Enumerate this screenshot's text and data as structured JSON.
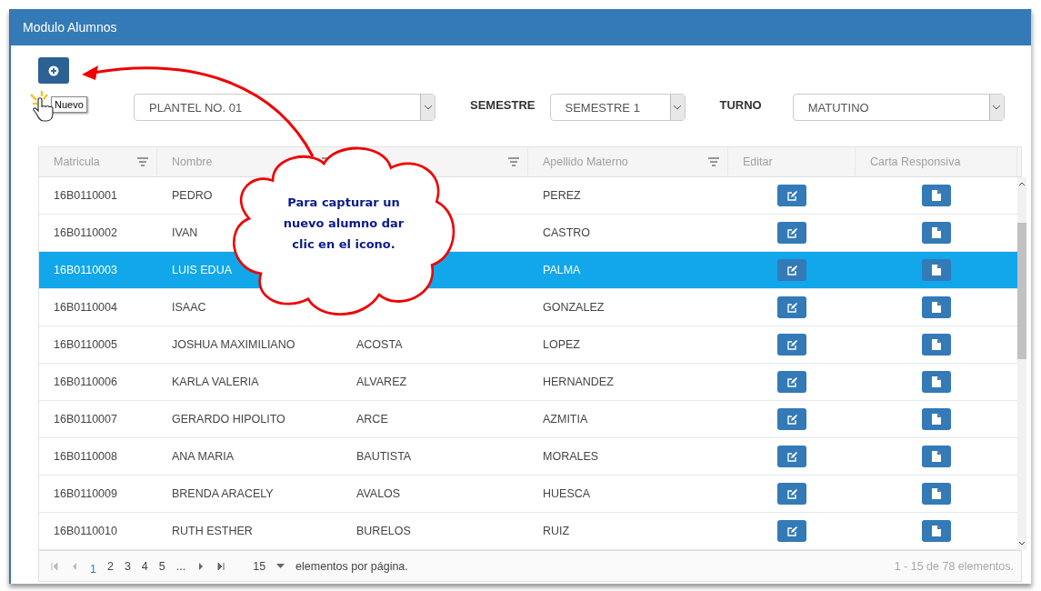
{
  "panel": {
    "title": "Modulo Alumnos"
  },
  "add_button": {
    "tooltip": "Nuevo"
  },
  "filters": [
    {
      "value": "PLANTEL NO. 01"
    },
    {
      "label": "SEMESTRE",
      "value": "SEMESTRE 1"
    },
    {
      "label": "TURNO",
      "value": "MATUTINO"
    }
  ],
  "table": {
    "columns": [
      {
        "label": "Matricula",
        "filter": true
      },
      {
        "label": "Nombre",
        "filter": true
      },
      {
        "filter": true
      },
      {
        "label": "Apellido Materno",
        "filter": true
      },
      {
        "label": "Editar",
        "filter": false
      },
      {
        "label": "Carta Responsiva",
        "filter": false
      }
    ],
    "rows": [
      {
        "matricula": "16B0110001",
        "nombre": "PEDRO",
        "materno": "PEREZ",
        "selected": false
      },
      {
        "matricula": "16B0110002",
        "nombre": "IVAN",
        "materno": "CASTRO",
        "selected": false
      },
      {
        "matricula": "16B0110003",
        "nombre": "LUIS EDUA",
        "materno": "PALMA",
        "selected": true
      },
      {
        "matricula": "16B0110004",
        "nombre": "ISAAC",
        "materno": "GONZALEZ",
        "selected": false
      },
      {
        "matricula": "16B0110005",
        "nombre": "JOSHUA MAXIMILIANO",
        "paterno": "ACOSTA",
        "materno": "LOPEZ",
        "selected": false
      },
      {
        "matricula": "16B0110006",
        "nombre": "KARLA VALERIA",
        "paterno": "ALVAREZ",
        "materno": "HERNANDEZ",
        "selected": false
      },
      {
        "matricula": "16B0110007",
        "nombre": "GERARDO HIPOLITO",
        "paterno": "ARCE",
        "materno": "AZMITIA",
        "selected": false
      },
      {
        "matricula": "16B0110008",
        "nombre": "ANA MARIA",
        "paterno": "BAUTISTA",
        "materno": "MORALES",
        "selected": false
      },
      {
        "matricula": "16B0110009",
        "nombre": "BRENDA ARACELY",
        "paterno": "AVALOS",
        "materno": "HUESCA",
        "selected": false
      },
      {
        "matricula": "16B0110010",
        "nombre": "RUTH ESTHER",
        "paterno": "BURELOS",
        "materno": "RUIZ",
        "selected": false
      }
    ]
  },
  "pager": {
    "pages": [
      {
        "label": "1",
        "selected": true
      },
      {
        "label": "2",
        "selected": false
      },
      {
        "label": "3",
        "selected": false
      },
      {
        "label": "4",
        "selected": false
      },
      {
        "label": "5",
        "selected": false
      },
      {
        "label": "...",
        "selected": false
      }
    ],
    "page_size": "15",
    "page_size_label": "elementos por página.",
    "summary": "1 - 15 de 78 elementos."
  },
  "callout": {
    "text": "Para capturar un nuevo alumno dar clic en el icono."
  }
}
